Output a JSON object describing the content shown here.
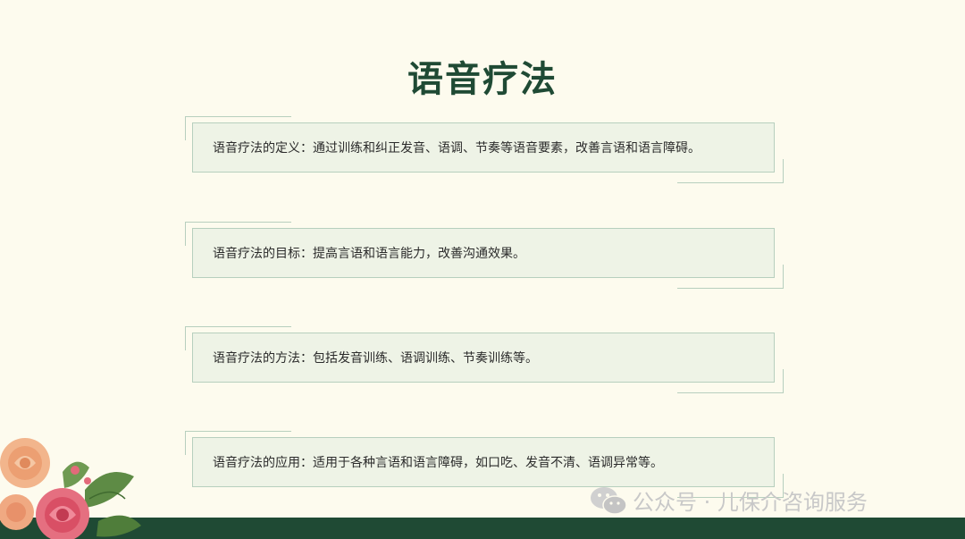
{
  "title": "语音疗法",
  "items": [
    {
      "text": "语音疗法的定义：通过训练和纠正发音、语调、节奏等语音要素，改善言语和语言障碍。"
    },
    {
      "text": "语音疗法的目标：提高言语和语言能力，改善沟通效果。"
    },
    {
      "text": "语音疗法的方法：包括发音训练、语调训练、节奏训练等。"
    },
    {
      "text": "语音疗法的应用：适用于各种言语和语言障碍，如口吃、发音不清、语调异常等。"
    }
  ],
  "watermark": "公众号 · 儿保介咨询服务",
  "colors": {
    "background": "#fdfbee",
    "title": "#1f4a34",
    "card_fill": "#eef3e6",
    "card_border": "#b7cfbe",
    "footer": "#1f4a34"
  },
  "icons": [
    "flower-decoration-icon",
    "wechat-icon"
  ]
}
